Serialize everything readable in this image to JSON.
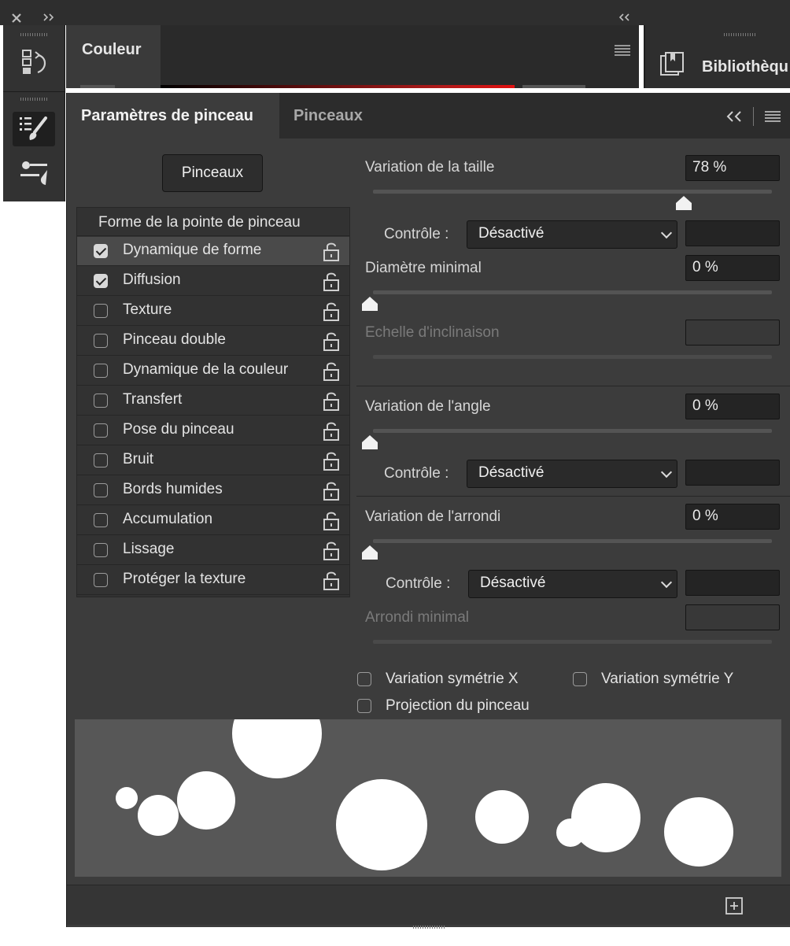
{
  "top_bar": {
    "close_icon": "close-x-icon",
    "expand_icon": "double-chevron-right-icon",
    "collapse_icon": "double-chevron-left-icon"
  },
  "tool_strip": {
    "history_icon": "history-icon",
    "brush_settings_icon": "brush-settings-icon",
    "brush_presets_icon": "brush-presets-icon"
  },
  "color_panel": {
    "tab_label": "Couleur",
    "menu_icon": "menu-icon"
  },
  "library_panel": {
    "label": "Bibliothèqu",
    "icon": "library-icon"
  },
  "brush_panel": {
    "tabs": [
      {
        "label": "Paramètres de pinceau",
        "active": true
      },
      {
        "label": "Pinceaux",
        "active": false
      }
    ],
    "collapse_icon": "double-chevron-left-icon",
    "menu_icon": "menu-icon",
    "brushes_button": "Pinceaux",
    "list_header": "Forme de la pointe de pinceau",
    "options": [
      {
        "label": "Dynamique de forme",
        "checked": true,
        "selected": true
      },
      {
        "label": "Diffusion",
        "checked": true,
        "selected": false
      },
      {
        "label": "Texture",
        "checked": false,
        "selected": false
      },
      {
        "label": "Pinceau double",
        "checked": false,
        "selected": false
      },
      {
        "label": "Dynamique de la couleur",
        "checked": false,
        "selected": false
      },
      {
        "label": "Transfert",
        "checked": false,
        "selected": false
      },
      {
        "label": "Pose du pinceau",
        "checked": false,
        "selected": false
      },
      {
        "label": "Bruit",
        "checked": false,
        "selected": false
      },
      {
        "label": "Bords humides",
        "checked": false,
        "selected": false
      },
      {
        "label": "Accumulation",
        "checked": false,
        "selected": false
      },
      {
        "label": "Lissage",
        "checked": false,
        "selected": false
      },
      {
        "label": "Protéger la texture",
        "checked": false,
        "selected": false
      }
    ],
    "size_jitter": {
      "label": "Variation de la taille",
      "value": "78 %",
      "level": 0.78,
      "control_label": "Contrôle :",
      "control_value": "Désactivé"
    },
    "min_diameter": {
      "label": "Diamètre minimal",
      "value": "0 %",
      "level": 0
    },
    "tilt_scale": {
      "label": "Echelle d'inclinaison",
      "value": ""
    },
    "angle_jitter": {
      "label": "Variation de l'angle",
      "value": "0 %",
      "level": 0,
      "control_label": "Contrôle :",
      "control_value": "Désactivé"
    },
    "roundness_jitter": {
      "label": "Variation de l'arrondi",
      "value": "0 %",
      "level": 0,
      "control_label": "Contrôle :",
      "control_value": "Désactivé"
    },
    "min_roundness": {
      "label": "Arrondi minimal",
      "value": ""
    },
    "flip_x": "Variation symétrie X",
    "flip_y": "Variation symétrie Y",
    "brush_projection": "Projection du pinceau",
    "new_brush_icon": "add-square-icon"
  }
}
